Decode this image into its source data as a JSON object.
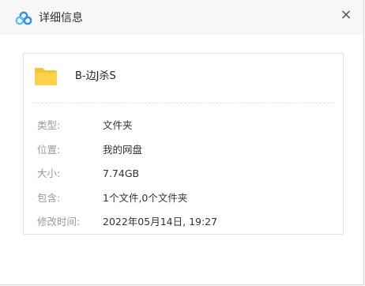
{
  "window": {
    "title": "详细信息",
    "close_glyph": "×"
  },
  "file": {
    "name": "B-边J杀S",
    "icon": "folder-icon"
  },
  "details": [
    {
      "label": "类型:",
      "value": "文件夹"
    },
    {
      "label": "位置:",
      "value": "我的网盘"
    },
    {
      "label": "大小:",
      "value": "7.74GB"
    },
    {
      "label": "包含:",
      "value": "1个文件,0个文件夹"
    },
    {
      "label": "修改时间:",
      "value": "2022年05月14日, 19:27"
    }
  ],
  "colors": {
    "folder": "#f7c531",
    "brand_blue": "#2f8ef0",
    "brand_light": "#5cc0f5"
  }
}
